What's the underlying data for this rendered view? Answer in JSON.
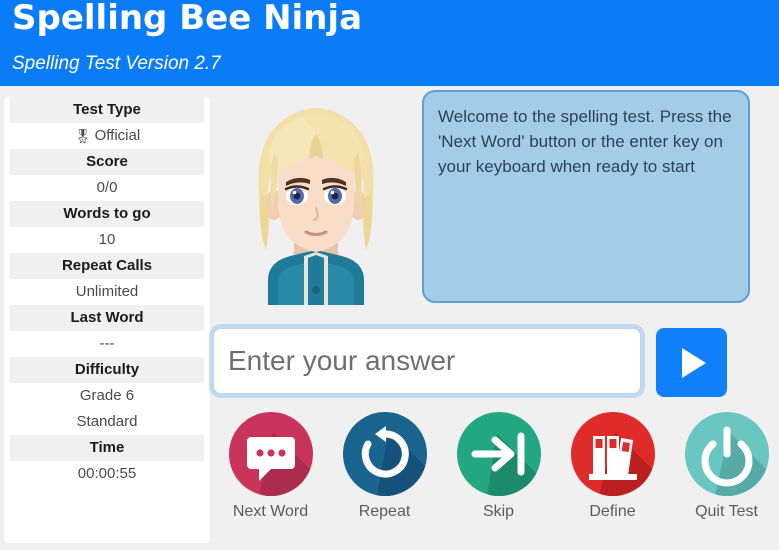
{
  "header": {
    "title": "Spelling Bee Ninja",
    "subtitle": "Spelling Test Version 2.7",
    "background_color": "#0b7cf8"
  },
  "sidebar": {
    "rows": [
      {
        "label": "Test Type",
        "value": "Official",
        "icon": "award-rosette-icon",
        "icon_glyph": "🎖"
      },
      {
        "label": "Score",
        "value": "0/0"
      },
      {
        "label": "Words to go",
        "value": "10"
      },
      {
        "label": "Repeat Calls",
        "value": "Unlimited"
      },
      {
        "label": "Last Word",
        "value": "---"
      },
      {
        "label": "Difficulty",
        "value": "Grade 6",
        "value2": "Standard"
      },
      {
        "label": "Time",
        "value": "00:00:55"
      }
    ]
  },
  "avatar": {
    "name": "student-avatar",
    "hair_color": "#f0dfa4",
    "skin_color": "#f6d9c4",
    "jacket_color": "#1f7b97",
    "eye_color": "#4b5fa8"
  },
  "message_box": {
    "text": "Welcome to the spelling test. Press the 'Next Word' button or the enter key on your keyboard when ready to start",
    "background_color": "#a3cce9",
    "border_color": "#5f9ed2",
    "text_color": "#2d4257"
  },
  "answer": {
    "placeholder": "Enter your answer",
    "value": "",
    "play_button_label": "play-audio",
    "play_button_color": "#1180fb"
  },
  "actions": [
    {
      "label": "Next Word",
      "icon": "speech-bubble-icon",
      "color": "#c9355a",
      "shadow": "#a82b4a"
    },
    {
      "label": "Repeat",
      "icon": "rotate-ccw-icon",
      "color": "#1a6490",
      "shadow": "#15527a"
    },
    {
      "label": "Skip",
      "icon": "arrow-to-bar-icon",
      "color": "#22a782",
      "shadow": "#1c8d6d"
    },
    {
      "label": "Define",
      "icon": "books-icon",
      "color": "#e02b2b",
      "shadow": "#b82121"
    },
    {
      "label": "Quit Test",
      "icon": "power-icon",
      "color": "#69c6c0",
      "shadow": "#57aaa5"
    }
  ]
}
